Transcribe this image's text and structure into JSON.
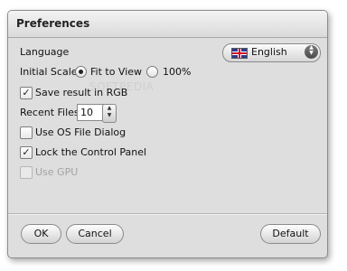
{
  "window": {
    "title": "Preferences"
  },
  "language": {
    "label": "Language",
    "selected": "English",
    "flag_icon": "uk-flag-icon"
  },
  "initial_scale": {
    "label": "Initial Scale",
    "options": [
      {
        "label": "Fit to View",
        "selected": true
      },
      {
        "label": "100%",
        "selected": false
      }
    ]
  },
  "save_rgb": {
    "label": "Save result in RGB",
    "checked": true
  },
  "recent_files": {
    "label": "Recent Files",
    "value": "10"
  },
  "os_dialog": {
    "label": "Use OS File Dialog",
    "checked": false
  },
  "lock_panel": {
    "label": "Lock the Control Panel",
    "checked": true
  },
  "use_gpu": {
    "label": "Use GPU",
    "checked": false,
    "disabled": true
  },
  "buttons": {
    "ok": "OK",
    "cancel": "Cancel",
    "default": "Default"
  },
  "colors": {
    "dialog_bg": "#dedede",
    "border": "#8c8c8c",
    "disabled_text": "#a3a3a3"
  },
  "watermark": "SOFTPEDIA"
}
